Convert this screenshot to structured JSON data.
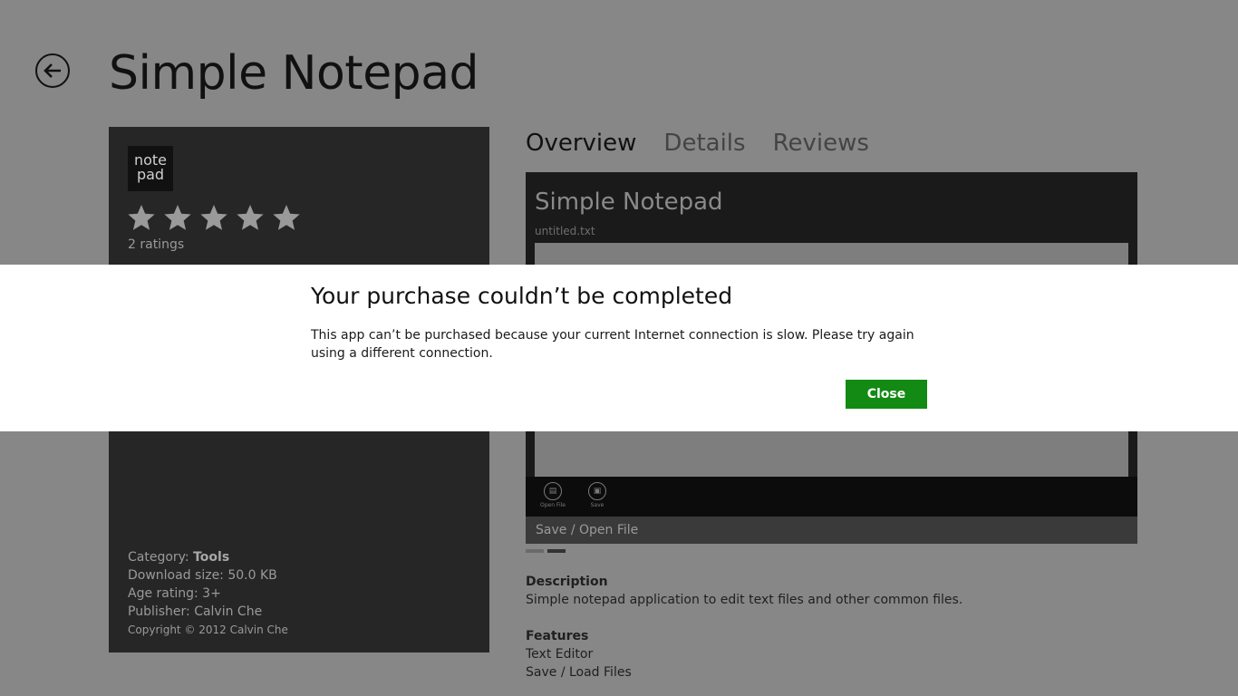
{
  "page": {
    "title": "Simple Notepad"
  },
  "info": {
    "logo_line1": "note",
    "logo_line2": "pad",
    "star_count": 5,
    "ratings": "2 ratings",
    "category_label": "Category:",
    "category_value": "Tools",
    "download_size": "Download size: 50.0 KB",
    "age_rating": "Age rating: 3+",
    "publisher": "Publisher: Calvin Che",
    "copyright": "Copyright © 2012 Calvin Che"
  },
  "tabs": [
    {
      "label": "Overview",
      "active": true
    },
    {
      "label": "Details",
      "active": false
    },
    {
      "label": "Reviews",
      "active": false
    }
  ],
  "screenshot": {
    "app_title": "Simple Notepad",
    "file_name": "untitled.txt",
    "open_label": "Open File",
    "save_label": "Save",
    "caption": "Save / Open File",
    "pages": 2,
    "current_page": 2
  },
  "description": {
    "heading": "Description",
    "text": "Simple notepad application to edit text files and other common files."
  },
  "features": {
    "heading": "Features",
    "items": [
      "Text Editor",
      "Save / Load Files"
    ]
  },
  "dialog": {
    "title": "Your purchase couldn’t be completed",
    "body": "This app can’t be purchased because your current Internet connection is slow. Please try again using a different connection.",
    "close_label": "Close"
  },
  "colors": {
    "accent": "#138a13",
    "background": "#878787",
    "panel": "#262626"
  }
}
